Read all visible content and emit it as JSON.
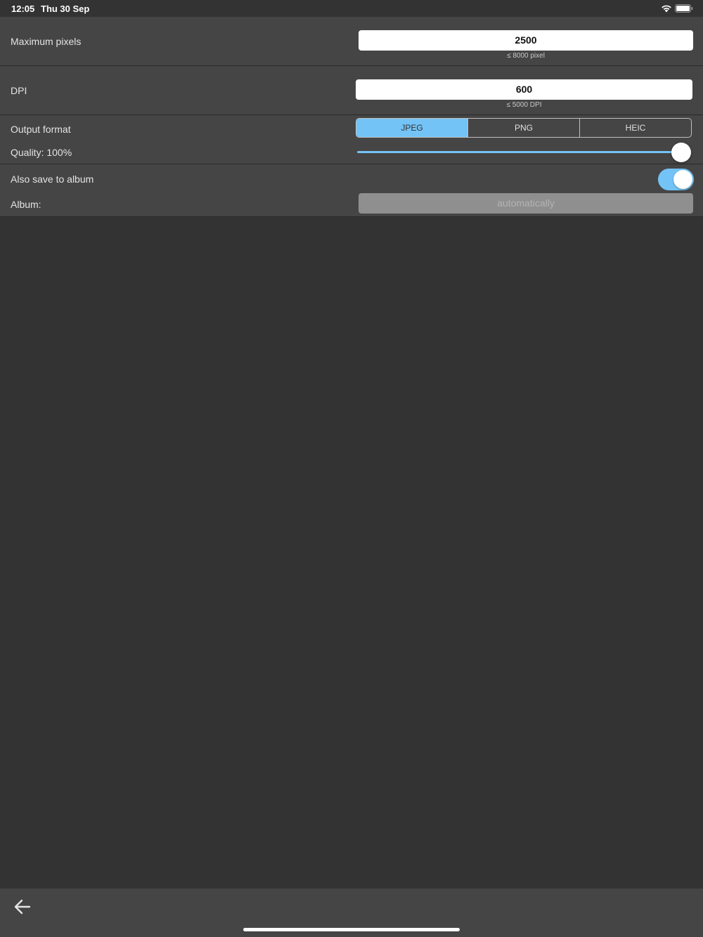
{
  "status_bar": {
    "time": "12:05",
    "date": "Thu 30 Sep"
  },
  "settings": {
    "max_pixels": {
      "label": "Maximum pixels",
      "value": "2500",
      "hint": "≤ 8000 pixel"
    },
    "dpi": {
      "label": "DPI",
      "value": "600",
      "hint": "≤ 5000 DPI"
    },
    "output_format": {
      "label": "Output format",
      "options": [
        "JPEG",
        "PNG",
        "HEIC"
      ],
      "selected": "JPEG"
    },
    "quality": {
      "label": "Quality: 100%",
      "value_fraction": 1.0
    },
    "save_to_album": {
      "label": "Also save to album",
      "enabled": true
    },
    "album": {
      "label": "Album:",
      "value": "automatically"
    }
  },
  "colors": {
    "accent": "#74c3f6",
    "background": "#333333",
    "section": "#454545"
  },
  "icons": {
    "back": "arrow-left-icon",
    "wifi": "wifi-icon",
    "battery": "battery-icon"
  }
}
